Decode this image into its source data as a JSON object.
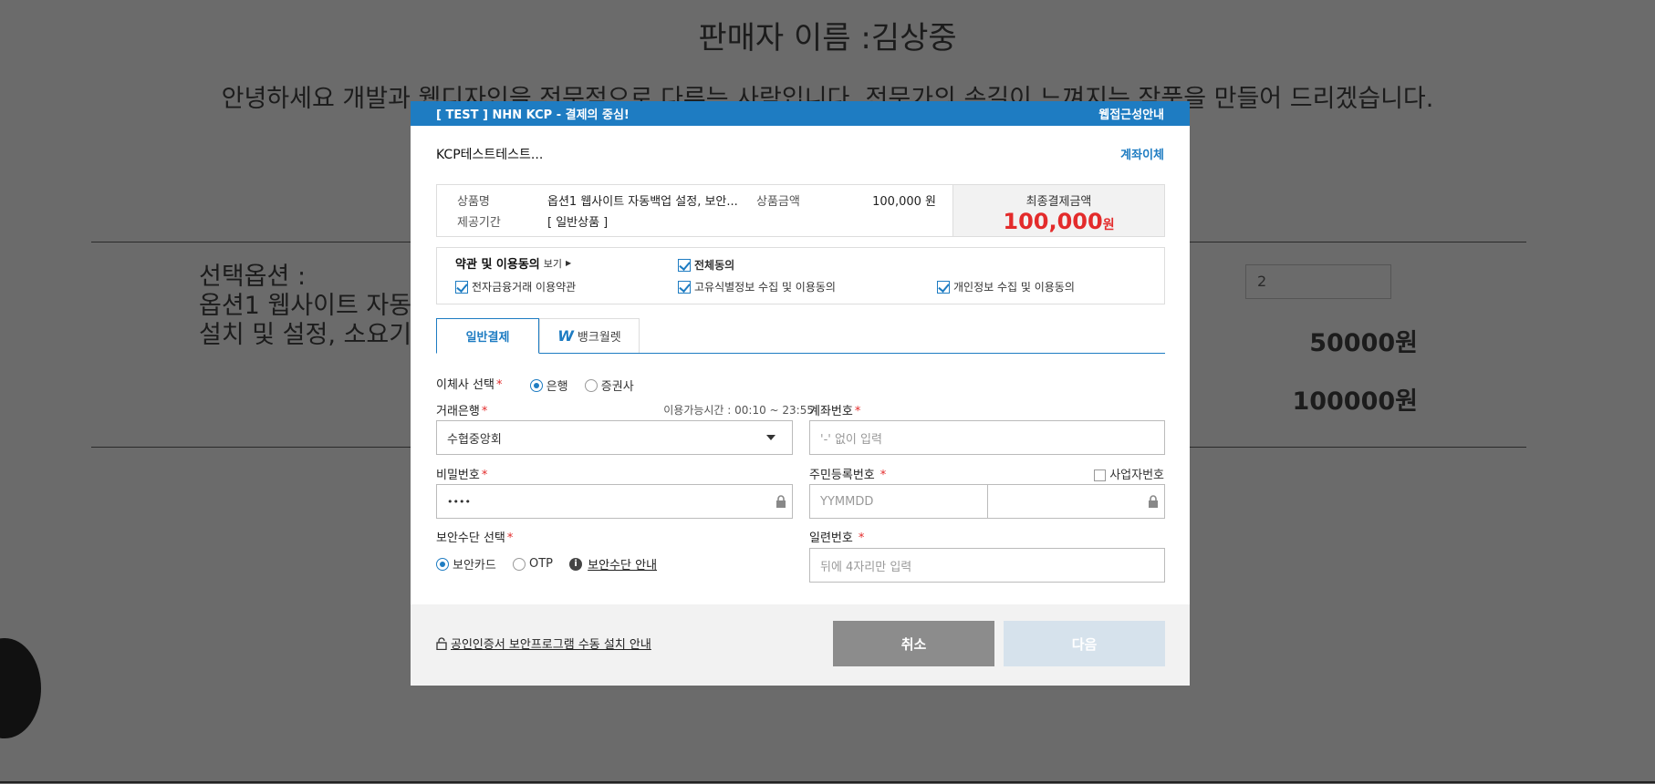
{
  "background": {
    "seller_name": "판매자 이름 :김상중",
    "intro": "안녕하세요 개발과 웹디자인을 전문적으로 다루는 사람입니다. 전문가의 손길이 느껴지는 작품을 만들어 드리겠습니다.",
    "option_label": "선택옵션 :",
    "option_line1": "옵션1 웹사이트 자동",
    "option_line2": "설치 및 설정, 소요기",
    "quantity": "2",
    "unit_price": "50000원",
    "total_price": "100000원"
  },
  "modal": {
    "header_title": "[ TEST ] NHN KCP - 결제의 중심!",
    "header_link": "웹접근성안내",
    "merchant": "KCP테스트테스트...",
    "method_link": "계좌이체",
    "product": {
      "name_label": "상품명",
      "name_value": "옵션1 웹사이트 자동백업 설정, 보안...",
      "period_label": "제공기간",
      "period_value": "[ 일반상품 ]",
      "amount_label": "상품금액",
      "amount_value": "100,000 원",
      "final_label": "최종결제금액",
      "final_value": "100,000",
      "final_unit": "원"
    },
    "terms": {
      "title": "약관 및 이용동의",
      "view": "보기",
      "all_agree": "전체동의",
      "item1": "전자금융거래 이용약관",
      "item2": "고유식별정보 수집 및 이용동의",
      "item3": "개인정보 수집 및 이용동의"
    },
    "tabs": {
      "general": "일반결제",
      "bankwallet": "뱅크월렛",
      "w": "W"
    },
    "form": {
      "transfer_select_label": "이체사 선택",
      "radio_bank": "은행",
      "radio_securities": "증권사",
      "bank_label": "거래은행",
      "hours": "이용가능시간 : 00:10 ~ 23:55",
      "bank_value": "수협중앙회",
      "account_label": "계좌번호",
      "account_placeholder": "'-' 없이 입력",
      "password_label": "비밀번호",
      "password_value": "••••",
      "rrn_label": "주민등록번호",
      "business_no": "사업자번호",
      "rrn_placeholder": "YYMMDD",
      "security_label": "보안수단 선택",
      "sec_card": "보안카드",
      "sec_otp": "OTP",
      "sec_guide": "보안수단 안내",
      "serial_label": "일련번호",
      "serial_placeholder": "뒤에 4자리만 입력",
      "required_mark": "*"
    },
    "footer": {
      "cert_link": "공인인증서 보안프로그램 수동 설치 안내",
      "cancel": "취소",
      "next": "다음"
    }
  }
}
